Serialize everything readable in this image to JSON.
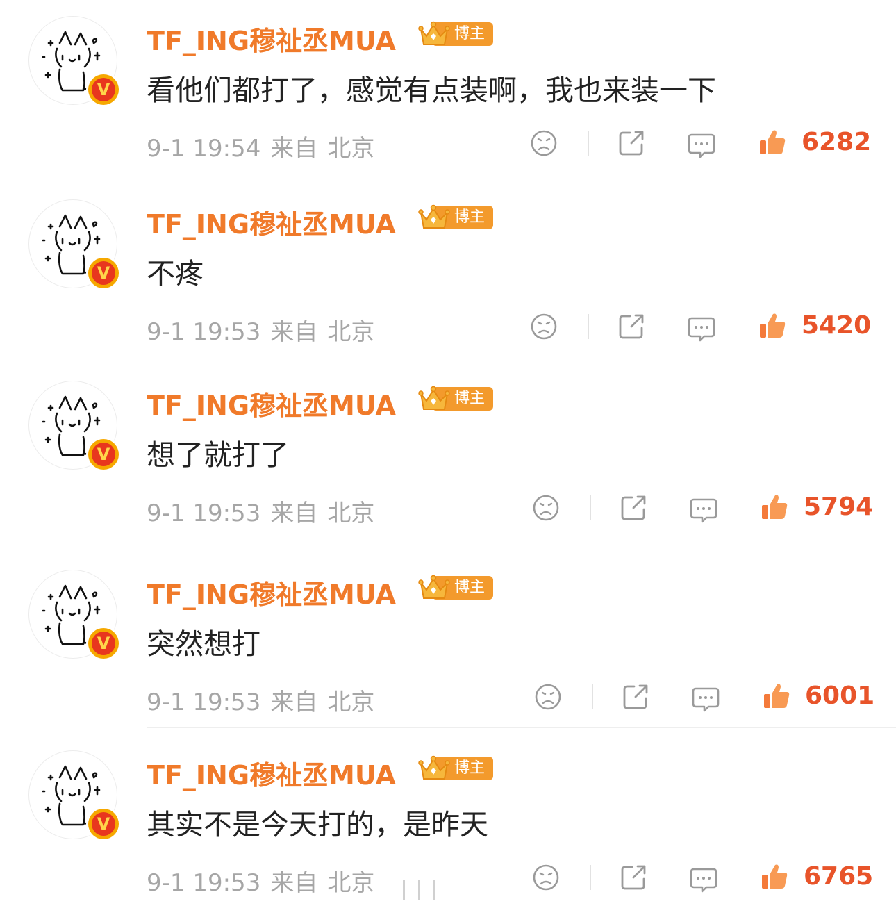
{
  "comments": [
    {
      "username": "TF_ING穆祉丞MUA",
      "author_label": "博主",
      "text": "看他们都打了，感觉有点装啊，我也来装一下",
      "date": "9-1 19:54",
      "from": "来自",
      "location": "北京",
      "likes": "6282"
    },
    {
      "username": "TF_ING穆祉丞MUA",
      "author_label": "博主",
      "text": "不疼",
      "date": "9-1 19:53",
      "from": "来自",
      "location": "北京",
      "likes": "5420"
    },
    {
      "username": "TF_ING穆祉丞MUA",
      "author_label": "博主",
      "text": "想了就打了",
      "date": "9-1 19:53",
      "from": "来自",
      "location": "北京",
      "likes": "5794"
    },
    {
      "username": "TF_ING穆祉丞MUA",
      "author_label": "博主",
      "text": "突然想打",
      "date": "9-1 19:53",
      "from": "来自",
      "location": "北京",
      "likes": "6001"
    },
    {
      "username": "TF_ING穆祉丞MUA",
      "author_label": "博主",
      "text": "其实不是今天打的，是昨天",
      "date": "9-1 19:53",
      "from": "来自",
      "location": "北京",
      "likes": "6765"
    }
  ],
  "icons": {
    "avatar": "line-drawn-cat-avatar",
    "verified": "v-verified-badge",
    "dislike": "frown-face-icon",
    "share": "share-icon",
    "reply": "comment-bubble-icon",
    "like": "thumbs-up-icon"
  },
  "colors": {
    "username": "#f07a2a",
    "like": "#e8542a",
    "author_tag": "#f39a2c",
    "meta": "#a6a6a6"
  }
}
